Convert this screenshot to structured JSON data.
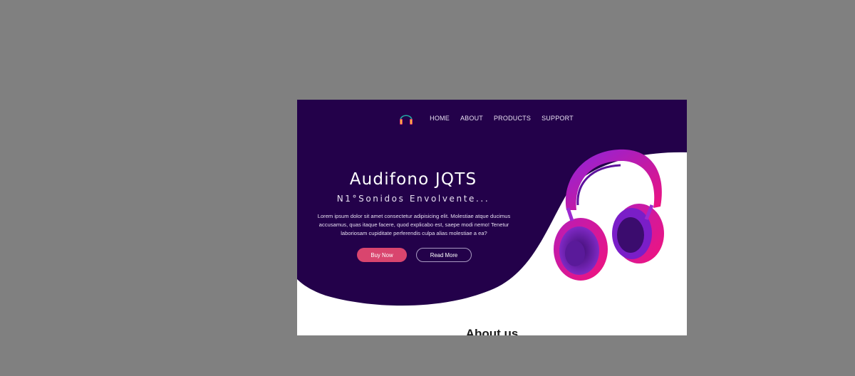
{
  "nav": {
    "logo_icon": "headphones-icon",
    "items": [
      {
        "label": "HOME"
      },
      {
        "label": "ABOUT"
      },
      {
        "label": "PRODUCTS"
      },
      {
        "label": "SUPPORT"
      }
    ]
  },
  "hero": {
    "title": "Audifono JQTS",
    "subtitle": "N1°Sonidos Envolvente...",
    "description": "Lorem ipsum dolor sit amet consectetur adipisicing elit. Molestiae atque ducimus accusamus, quas itaque facere, quod explicabo est, saepe modi nemo! Tenetur laboriosam cupiditate perferendis culpa alias molestiae a ea?",
    "buy_label": "Buy Now",
    "read_label": "Read More",
    "image_icon": "headphones-product-image"
  },
  "about": {
    "title": "About us"
  },
  "colors": {
    "backdrop": "#808080",
    "hero_bg": "#23014a",
    "buy_button": "#d9456e",
    "headphones_pink": "#e8127f",
    "headphones_purple": "#7a1ec8"
  }
}
